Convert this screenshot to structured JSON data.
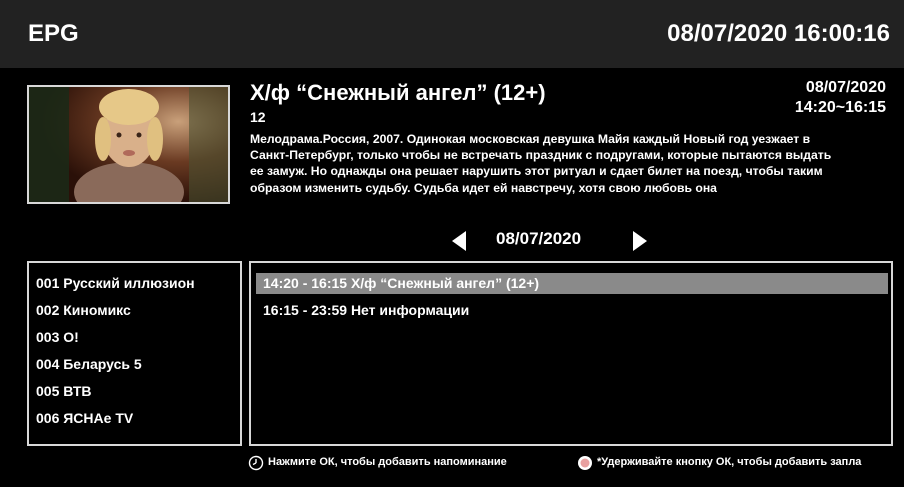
{
  "header": {
    "title": "EPG",
    "datetime": "08/07/2020 16:00:16"
  },
  "program": {
    "title": "Х/ф “Снежный ангел” (12+)",
    "age": "12",
    "date": "08/07/2020",
    "time": "14:20~16:15",
    "description": "Мелодрама.Россия, 2007. Одинокая московская девушка Майя каждый Новый год уезжает в Санкт-Петербург, только чтобы не встречать праздник с подругами, которые пытаются выдать ее замуж. Но однажды она решает нарушить этот ритуал и сдает билет на поезд, чтобы таким образом изменить судьбу. Судьба идет ей навстречу, хотя свою любовь она"
  },
  "date_nav": {
    "date": "08/07/2020"
  },
  "channels": [
    "001 Русский иллюзион",
    "002 Киномикс",
    "003 O!",
    "004 Беларусь 5",
    "005 ВТВ",
    "006 ЯСНАе TV"
  ],
  "schedule": [
    {
      "label": "14:20 - 16:15 Х/ф “Снежный ангел” (12+)",
      "selected": true
    },
    {
      "label": "16:15 - 23:59 Нет информации",
      "selected": false
    }
  ],
  "footer": {
    "reminder_hint": "Нажмите ОК, чтобы добавить напоминание",
    "record_hint": "*Удерживайте кнопку ОК, чтобы добавить запла"
  },
  "colors": {
    "header_bg": "#222222",
    "selected_row": "#8a8a8a",
    "border": "#d8d8d8",
    "record_icon": "#e8a0a0"
  },
  "icons": {
    "reminder": "clock-icon",
    "record": "record-icon"
  }
}
